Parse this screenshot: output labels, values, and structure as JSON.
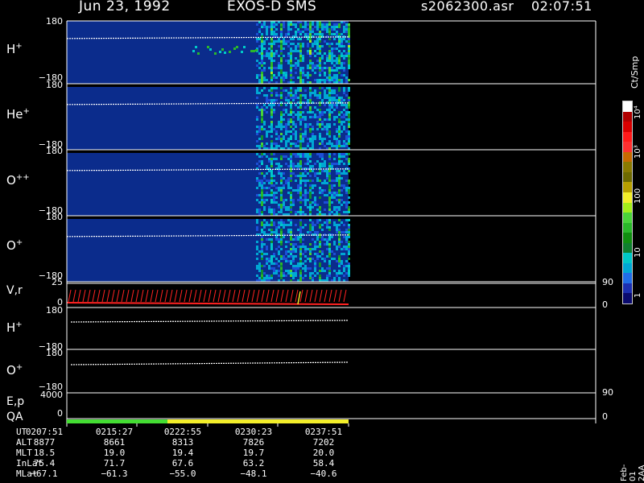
{
  "header": {
    "date": "Jun 23, 1992",
    "instrument": "EXOS-D SMS",
    "file": "s2062300.asr",
    "time": "02:07:51"
  },
  "colors": {
    "background": "#000000",
    "spectrogram_bg": "#0b2c8c",
    "qa_green": "#44dd33",
    "qa_yellow": "#f3ee2a",
    "trace": "#ffffff",
    "vector": "#ff2222"
  },
  "panels": {
    "h_plus": {
      "ion": "H",
      "charge": "+",
      "ymax": "180",
      "ymin": "−180"
    },
    "he_plus": {
      "ion": "He",
      "charge": "+",
      "ymax": "180",
      "ymin": "−180"
    },
    "o_pp": {
      "ion": "O",
      "charge": "++",
      "ymax": "180",
      "ymin": "−180"
    },
    "o_plus": {
      "ion": "O",
      "charge": "+",
      "ymax": "180",
      "ymin": "−180"
    },
    "vr": {
      "label": "V,r",
      "ymax": "25",
      "ymin": "0",
      "right_top": "90",
      "right_bottom": "0"
    },
    "h_plus_line": {
      "ion": "H",
      "charge": "+",
      "ymax": "180",
      "ymin": "−180"
    },
    "o_plus_line": {
      "ion": "O",
      "charge": "+",
      "ymax": "180",
      "ymin": "−180"
    },
    "ep": {
      "label": "E,p",
      "ymax": "4000",
      "right_top": "90"
    },
    "qa": {
      "label": "QA",
      "ymin": "0",
      "right_bottom": "0"
    }
  },
  "colorbar": {
    "title": "Ct/Smp",
    "tick_labels": [
      "1",
      "10",
      "100",
      "10³",
      "10⁴"
    ],
    "colors": [
      "#ffffff",
      "#b00000",
      "#d80000",
      "#ff1a1a",
      "#ff3030",
      "#c86a00",
      "#8a7a00",
      "#6e6a00",
      "#b8a000",
      "#f3ee2a",
      "#a4ee1a",
      "#4ad43a",
      "#2ab82a",
      "#108e10",
      "#0f7f2f",
      "#00c8c8",
      "#00a7d4",
      "#206de8",
      "#1c2fb2",
      "#0a0a6e"
    ]
  },
  "orbit_table": {
    "rows": [
      {
        "label": "UT",
        "values": [
          "0207:51",
          "0215:27",
          "0222:55",
          "0230:23",
          "0237:51"
        ]
      },
      {
        "label": "ALT",
        "values": [
          "8877",
          "8661",
          "8313",
          "7826",
          "7202"
        ]
      },
      {
        "label": "MLT",
        "values": [
          "18.5",
          "19.0",
          "19.4",
          "19.7",
          "20.0"
        ]
      },
      {
        "label": "InLat",
        "values": [
          "75.4",
          "71.7",
          "67.6",
          "63.2",
          "58.4"
        ]
      },
      {
        "label": "MLat",
        "values": [
          "−67.1",
          "−61.3",
          "−55.0",
          "−48.1",
          "−40.6"
        ]
      }
    ]
  },
  "side_stamp": "Feb-01 2AA",
  "chart_data": {
    "type": "heatmap",
    "title": "Jun 23, 1992 EXOS-D SMS",
    "x_axis_ut": [
      "0207:51",
      "0215:27",
      "0222:55",
      "0230:23",
      "0237:51"
    ],
    "colorbar_scale": "log",
    "colorbar_range": [
      1,
      10000
    ],
    "qa_segments": [
      {
        "from": "0207:51",
        "to": "0215:27",
        "color": "green"
      },
      {
        "from": "0215:27",
        "to": "0237:51",
        "color": "yellow"
      }
    ]
  }
}
